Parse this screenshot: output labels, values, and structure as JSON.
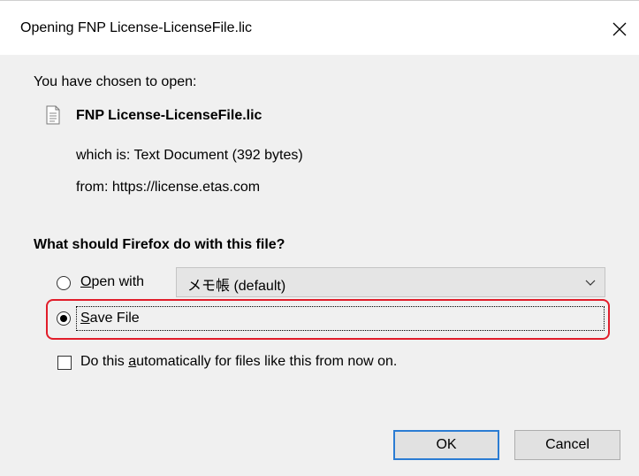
{
  "window": {
    "title": "Opening FNP License-LicenseFile.lic",
    "close_symbol": "×"
  },
  "dialog": {
    "intro": "You have chosen to open:",
    "file_icon": "text-document-icon",
    "file_name": "FNP License-LicenseFile.lic",
    "which_is": "which is: Text Document (392 bytes)",
    "from": "from: https://license.etas.com",
    "question": "What should Firefox do with this file?",
    "open_with": {
      "label_prefix": "",
      "label_mnemonic": "O",
      "label_rest": "pen with",
      "selected": false,
      "app_value": "メモ帳 (default)"
    },
    "save_file": {
      "label_mnemonic": "S",
      "label_rest": "ave File",
      "selected": true
    },
    "auto": {
      "label_before": "Do this ",
      "label_mnemonic": "a",
      "label_after": "utomatically for files like this from now on.",
      "checked": false
    },
    "buttons": {
      "ok": "OK",
      "cancel": "Cancel"
    },
    "highlight_color": "#e11d2a"
  }
}
